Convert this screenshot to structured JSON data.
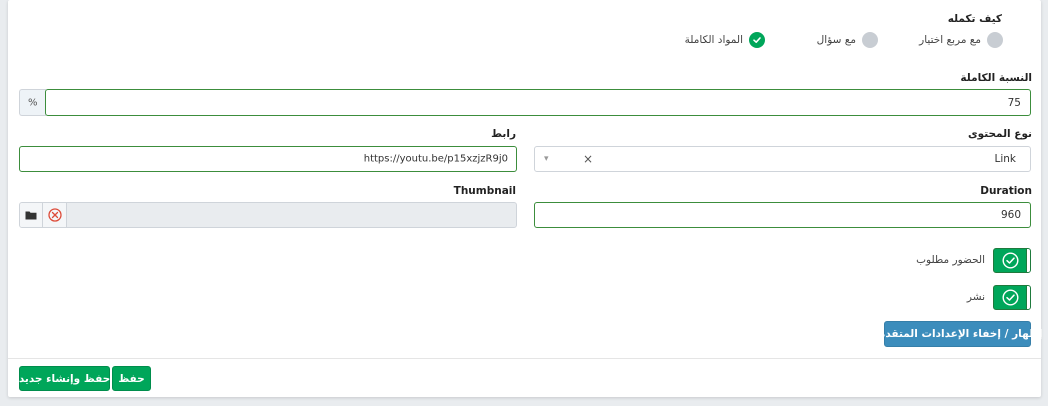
{
  "completion": {
    "title": "كيف تكمله",
    "options": [
      {
        "label": "مع مربع اختيار",
        "selected": false
      },
      {
        "label": "مع سؤال",
        "selected": false
      },
      {
        "label": "المواد الكاملة",
        "selected": true
      }
    ]
  },
  "percentage": {
    "label": "النسبة الكاملة",
    "value": "75",
    "addon": "%"
  },
  "content_type": {
    "label": "نوع المحتوى",
    "value": "Link",
    "clear": "×",
    "arrow": "▾"
  },
  "link": {
    "label": "رابط",
    "value": "https://youtu.be/p15xzjzR9j0"
  },
  "duration": {
    "label": "Duration",
    "value": "960"
  },
  "thumbnail": {
    "label": "Thumbnail",
    "value": ""
  },
  "toggles": {
    "attendance_label": "الحضور مطلوب",
    "attendance_on": true,
    "publish_label": "نشر",
    "publish_on": true
  },
  "advanced_button": "إظهار / إخفاء الإعدادات المتقدمة",
  "footer": {
    "save": "حفظ",
    "save_new": "حفظ وإنشاء جديد"
  },
  "colors": {
    "accent_green": "#00a65a",
    "accent_blue": "#3c8dbc",
    "field_border": "#3c8d3c"
  }
}
